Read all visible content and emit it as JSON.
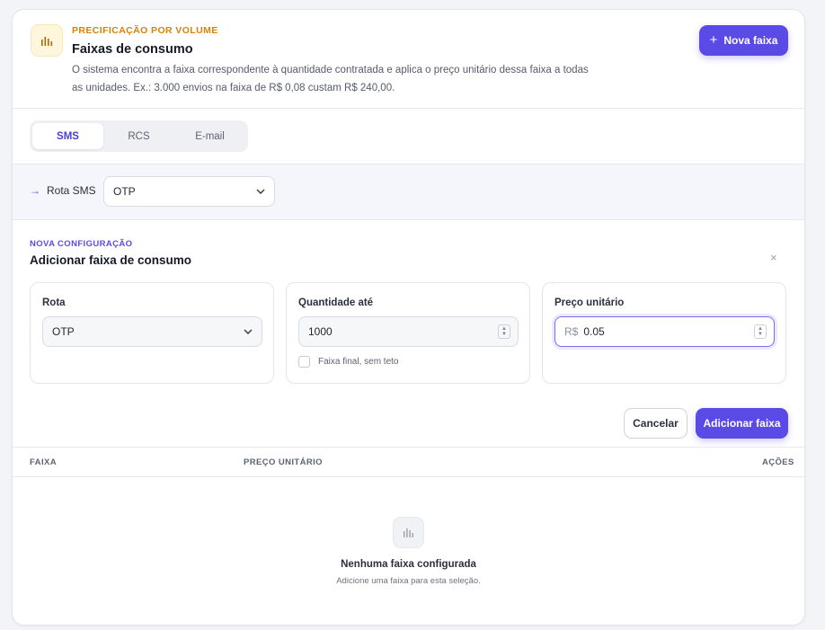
{
  "header": {
    "eyebrow": "PRECIFICAÇÃO POR VOLUME",
    "title": "Faixas de consumo",
    "description": "O sistema encontra a faixa correspondente à quantidade contratada e aplica o preço unitário dessa faixa a todas as unidades. Ex.: 3.000 envios na faixa de R$ 0,08 custam R$ 240,00.",
    "icon": "bar-chart-icon",
    "new_button_label": "Nova faixa"
  },
  "tabs": [
    {
      "label": "SMS",
      "active": true
    },
    {
      "label": "RCS",
      "active": false
    },
    {
      "label": "E-mail",
      "active": false
    }
  ],
  "route_filter": {
    "label": "Rota SMS",
    "selected": "OTP"
  },
  "new_config": {
    "eyebrow": "NOVA CONFIGURAÇÃO",
    "title": "Adicionar faixa de consumo",
    "close_label": "×",
    "fields": {
      "route": {
        "label": "Rota",
        "selected": "OTP"
      },
      "quantity": {
        "label": "Quantidade até",
        "value": "1000",
        "checkbox_label": "Faixa final, sem teto",
        "checkbox_checked": false
      },
      "price": {
        "label": "Preço unitário",
        "prefix": "R$",
        "value": "0.05"
      }
    },
    "cancel_label": "Cancelar",
    "submit_label": "Adicionar faixa"
  },
  "table": {
    "columns": [
      "FAIXA",
      "PREÇO UNITÁRIO",
      "AÇÕES"
    ],
    "empty_title": "Nenhuma faixa configurada",
    "empty_subtitle": "Adicione uma faixa para esta seleção."
  },
  "colors": {
    "accent": "#5b4be6",
    "eyebrow_orange": "#d9820a",
    "background": "#f3f4f7"
  }
}
